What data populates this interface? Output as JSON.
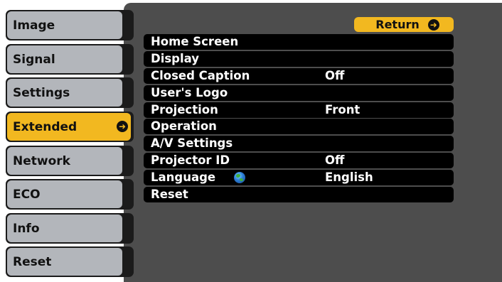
{
  "sidebar": {
    "items": [
      {
        "label": "Image",
        "active": false
      },
      {
        "label": "Signal",
        "active": false
      },
      {
        "label": "Settings",
        "active": false
      },
      {
        "label": "Extended",
        "active": true
      },
      {
        "label": "Network",
        "active": false
      },
      {
        "label": "ECO",
        "active": false
      },
      {
        "label": "Info",
        "active": false
      },
      {
        "label": "Reset",
        "active": false
      }
    ]
  },
  "return_button": {
    "label": "Return",
    "icon": "enter-icon"
  },
  "menu": {
    "rows": [
      {
        "label": "Home Screen",
        "value": ""
      },
      {
        "label": "Display",
        "value": ""
      },
      {
        "label": "Closed Caption",
        "value": "Off"
      },
      {
        "label": "User's Logo",
        "value": ""
      },
      {
        "label": "Projection",
        "value": "Front"
      },
      {
        "label": "Operation",
        "value": ""
      },
      {
        "label": "A/V Settings",
        "value": ""
      },
      {
        "label": "Projector ID",
        "value": "Off"
      },
      {
        "label": "Language",
        "value": "English",
        "icon": "globe-icon"
      },
      {
        "label": "Reset",
        "value": ""
      }
    ]
  },
  "colors": {
    "active_accent": "#f2b820",
    "sidebar_item": "#b3b6bb",
    "panel_background": "#4d4d4d",
    "row_background": "#000000"
  }
}
